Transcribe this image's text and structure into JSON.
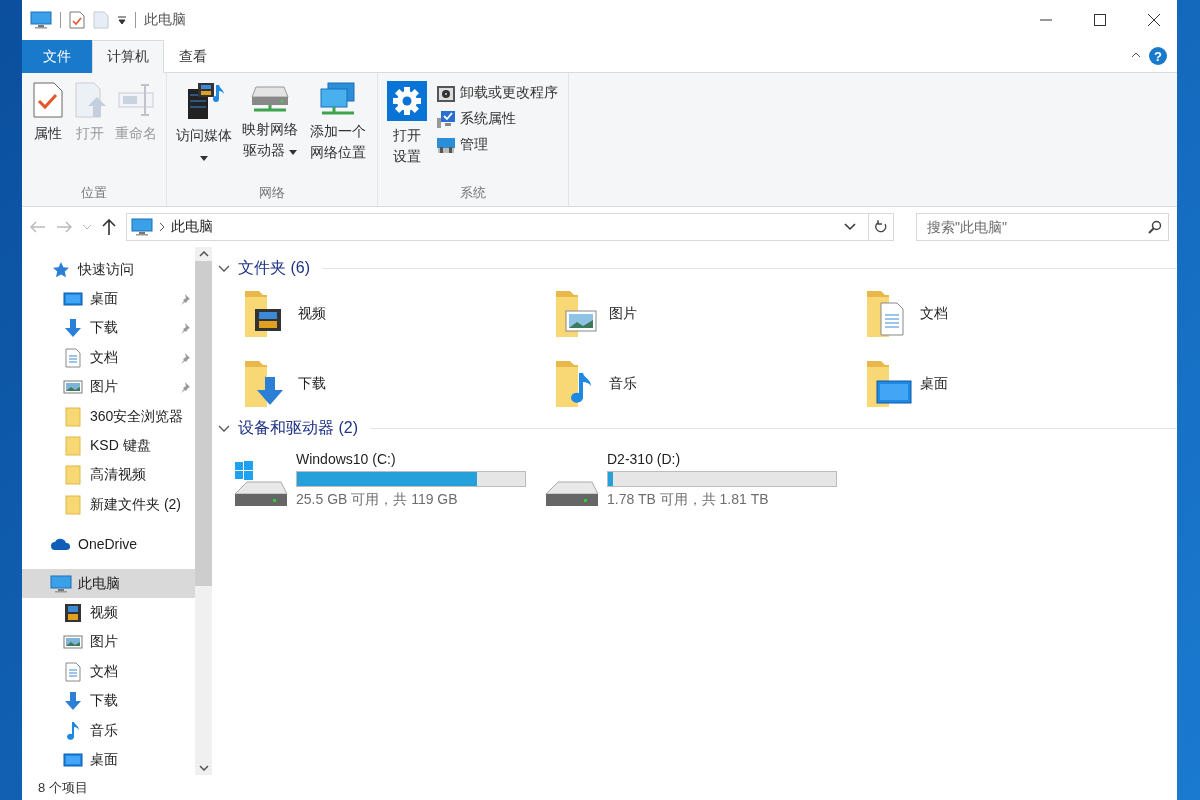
{
  "title_bar": {
    "title": "此电脑"
  },
  "ribbon_tabs": [
    {
      "label": "文件",
      "kind": "file",
      "selected": false
    },
    {
      "label": "计算机",
      "kind": "tab",
      "selected": true
    },
    {
      "label": "查看",
      "kind": "tab",
      "selected": false
    }
  ],
  "help": "?",
  "ribbon_groups": [
    {
      "label": "位置",
      "buttons": [
        {
          "label": "属性",
          "kind": "properties",
          "disabled": false
        },
        {
          "label": "打开",
          "kind": "open",
          "disabled": true
        },
        {
          "label": "重命名",
          "kind": "rename",
          "disabled": true
        }
      ]
    },
    {
      "label": "网络",
      "buttons": [
        {
          "label": "访问媒体",
          "kind": "media",
          "disabled": false
        },
        {
          "label": "映射网络驱动器",
          "kind": "mapdrive",
          "disabled": false
        },
        {
          "label": "添加一个网络位置",
          "kind": "netloc",
          "disabled": false
        }
      ]
    },
    {
      "label": "系统",
      "buttons": [
        {
          "label": "打开设置",
          "kind": "settings",
          "disabled": false
        },
        {
          "label": "卸载或更改程序",
          "kind": "uninstall",
          "disabled": false
        },
        {
          "label": "系统属性",
          "kind": "sysprops",
          "disabled": false
        },
        {
          "label": "管理",
          "kind": "manage",
          "disabled": false
        }
      ]
    }
  ],
  "address_bar": {
    "path": "此电脑"
  },
  "search": {
    "placeholder": "搜索\"此电脑\""
  },
  "sidebar": {
    "items": [
      {
        "label": "快速访问",
        "kind": "star",
        "selected": false,
        "children": [
          {
            "label": "桌面",
            "kind": "desktop",
            "pinned": true,
            "selected": false
          },
          {
            "label": "下载",
            "kind": "download",
            "pinned": true,
            "selected": false
          },
          {
            "label": "文档",
            "kind": "doc",
            "pinned": true,
            "selected": false
          },
          {
            "label": "图片",
            "kind": "picture",
            "pinned": true,
            "selected": false
          },
          {
            "label": "360安全浏览器",
            "kind": "folder",
            "pinned": false,
            "selected": false
          },
          {
            "label": "KSD 键盘",
            "kind": "folder",
            "pinned": false,
            "selected": false
          },
          {
            "label": "高清视频",
            "kind": "folder",
            "pinned": false,
            "selected": false
          },
          {
            "label": "新建文件夹 (2)",
            "kind": "folder",
            "pinned": false,
            "selected": false
          }
        ]
      },
      {
        "label": "OneDrive",
        "kind": "cloud",
        "selected": false
      },
      {
        "label": "此电脑",
        "kind": "computer",
        "selected": true,
        "children": [
          {
            "label": "视频",
            "kind": "video",
            "pinned": false,
            "selected": false
          },
          {
            "label": "图片",
            "kind": "picture",
            "pinned": false,
            "selected": false
          },
          {
            "label": "文档",
            "kind": "doc",
            "pinned": false,
            "selected": false
          },
          {
            "label": "下载",
            "kind": "download",
            "pinned": false,
            "selected": false
          },
          {
            "label": "音乐",
            "kind": "music",
            "pinned": false,
            "selected": false
          },
          {
            "label": "桌面",
            "kind": "desktop",
            "pinned": false,
            "selected": false
          }
        ]
      }
    ]
  },
  "sections": [
    {
      "title": "文件夹 (6)",
      "kind": "folders",
      "expanded": true,
      "items": [
        {
          "name": "视频",
          "kind": "video"
        },
        {
          "name": "图片",
          "kind": "picture"
        },
        {
          "name": "文档",
          "kind": "doc"
        },
        {
          "name": "下载",
          "kind": "download"
        },
        {
          "name": "音乐",
          "kind": "music"
        },
        {
          "name": "桌面",
          "kind": "desktop"
        }
      ]
    },
    {
      "title": "设备和驱动器 (2)",
      "kind": "drives",
      "expanded": true,
      "items": [
        {
          "name": "Windows10 (C:)",
          "kind": "windows",
          "level": 0.79,
          "free": "25.5 GB 可用，共 119 GB"
        },
        {
          "name": "D2-310 (D:)",
          "kind": "plain",
          "level": 0.02,
          "free": "1.78 TB 可用，共 1.81 TB"
        }
      ]
    }
  ],
  "status_bar": {
    "count": "8 个项目"
  }
}
